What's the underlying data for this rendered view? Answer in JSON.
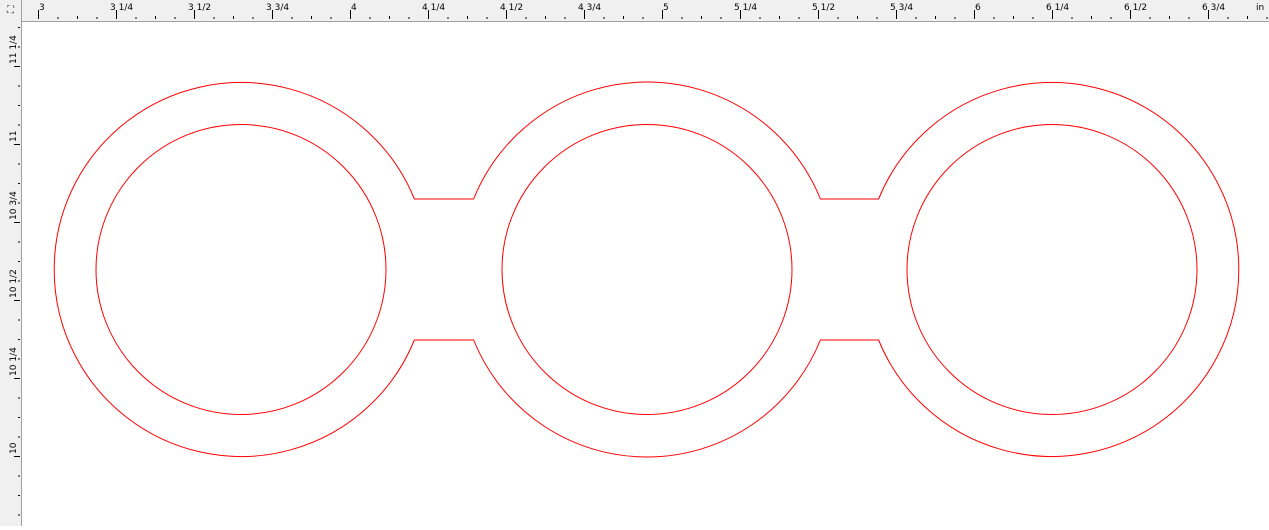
{
  "rulers": {
    "unit": "in",
    "horizontal_labels": [
      "3",
      "3 1/4",
      "3 1/2",
      "3 3/4",
      "4",
      "4 1/4",
      "4 1/2",
      "4 3/4",
      "5",
      "5 1/4",
      "5 1/2",
      "5 3/4",
      "6",
      "6 1/4",
      "6 1/2",
      "6 3/4"
    ],
    "vertical_labels": [
      "11 1/4",
      "11",
      "10 3/4",
      "10 1/2",
      "10 1/4",
      "10"
    ]
  },
  "corner_icon": "ruler-origin-icon",
  "drawing": {
    "stroke_color": "#ff0000",
    "shapes": [
      "outer-outline",
      "inner-circle-1",
      "inner-circle-2",
      "inner-circle-3"
    ]
  }
}
